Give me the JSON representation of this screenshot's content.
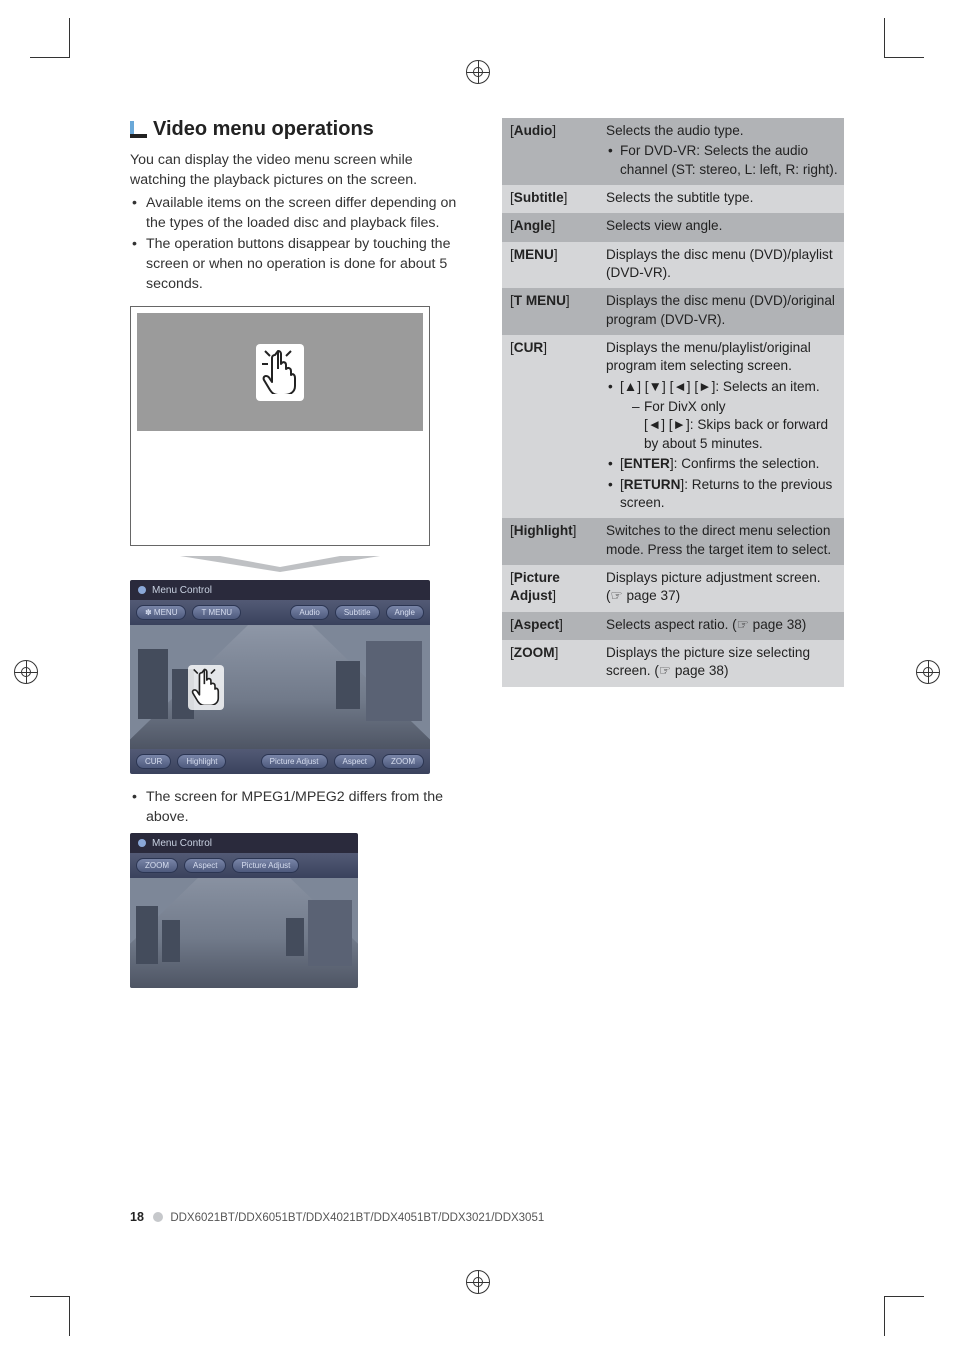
{
  "heading": "Video menu operations",
  "intro": "You can display the video menu screen while watching the playback pictures on the screen.",
  "intro_bullets": [
    "Available items on the screen differ depending on the types of the loaded disc and playback files.",
    "The operation buttons disappear by touching the screen or when no operation is done for about 5 seconds."
  ],
  "mpeg_note": "The screen for MPEG1/MPEG2 differs from the above.",
  "screenshot": {
    "title": "Menu Control",
    "top_chips_left": [
      "✽ MENU",
      "T MENU"
    ],
    "top_chips_right": [
      "Audio",
      "Subtitle",
      "Angle"
    ],
    "bottom_chips_left": [
      "CUR",
      "Highlight"
    ],
    "bottom_chips_right": [
      "Picture Adjust",
      "Aspect",
      "ZOOM"
    ]
  },
  "screenshot2": {
    "title": "Menu Control",
    "top_chips_left": [
      "ZOOM",
      "Aspect",
      "Picture Adjust"
    ]
  },
  "table": [
    {
      "label": "Audio",
      "desc": "Selects the audio type.",
      "bullets": [
        "For DVD-VR: Selects the audio channel (ST: stereo, L: left, R: right)."
      ],
      "shade": "dark"
    },
    {
      "label": "Subtitle",
      "desc": "Selects the subtitle type.",
      "shade": "light"
    },
    {
      "label": "Angle",
      "desc": "Selects view angle.",
      "shade": "dark"
    },
    {
      "label": "MENU",
      "desc": "Displays the disc menu (DVD)/playlist (DVD-VR).",
      "shade": "light"
    },
    {
      "label": "T MENU",
      "desc": "Displays the disc menu (DVD)/original program (DVD-VR).",
      "shade": "dark"
    },
    {
      "label": "CUR",
      "desc": "Displays the menu/playlist/original program item selecting screen.",
      "bullets": [
        {
          "text": "[▲] [▼] [◄] [►]: Selects an item.",
          "sub": [
            "For DivX only\n[◄] [►]: Skips back or forward by about 5 minutes."
          ]
        },
        "[ENTER]: Confirms the selection.",
        "[RETURN]: Returns to the previous screen."
      ],
      "shade": "light"
    },
    {
      "label": "Highlight",
      "desc": "Switches to the direct menu selection mode. Press the target item to select.",
      "shade": "dark"
    },
    {
      "label": "Picture Adjust",
      "desc": "Displays picture adjustment screen. (☞ page 37)",
      "shade": "light"
    },
    {
      "label": "Aspect",
      "desc": "Selects aspect ratio. (☞ page 38)",
      "shade": "dark"
    },
    {
      "label": "ZOOM",
      "desc": "Displays the picture size selecting screen. (☞ page 38)",
      "shade": "light"
    }
  ],
  "footer": {
    "page": "18",
    "models": "DDX6021BT/DDX6051BT/DDX4021BT/DDX4051BT/DDX3021/DDX3051"
  }
}
